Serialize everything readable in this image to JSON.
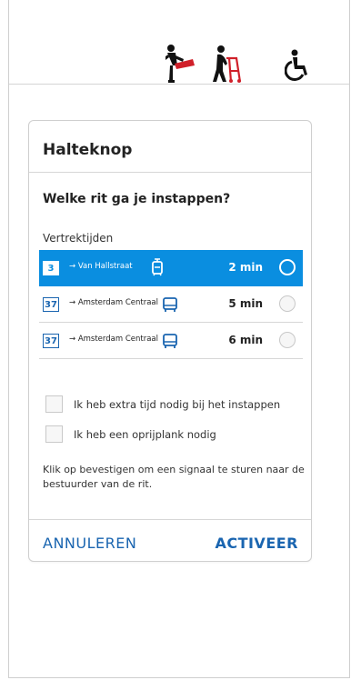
{
  "icons": {
    "kick": "leg-kick-icon",
    "elderly": "elderly-walker-icon",
    "wheelchair": "wheelchair-icon"
  },
  "dialog": {
    "title": "Halteknop",
    "question": "Welke rit ga je instappen?",
    "departures_header": "Vertrektijden",
    "rows": [
      {
        "line": "3",
        "dest": "→ Van Hallstraat",
        "time": "2 min",
        "vehicle": "tram-icon",
        "selected": true
      },
      {
        "line": "37",
        "dest": "→ Amsterdam Centraal",
        "time": "5 min",
        "vehicle": "bus-icon",
        "selected": false
      },
      {
        "line": "37",
        "dest": "→ Amsterdam Centraal",
        "time": "6 min",
        "vehicle": "bus-icon",
        "selected": false
      }
    ],
    "options": [
      {
        "label": "Ik heb extra tijd nodig bij het instappen",
        "checked": false
      },
      {
        "label": "Ik heb een oprijplank nodig",
        "checked": false
      }
    ],
    "info": "Klik op bevestigen om een signaal te sturen naar de bestuurder van de rit.",
    "cancel_label": "ANNULEREN",
    "activate_label": "ACTIVEER"
  },
  "colors": {
    "accent": "#0a8ee0",
    "link": "#1a65b0",
    "red": "#d0202a"
  }
}
